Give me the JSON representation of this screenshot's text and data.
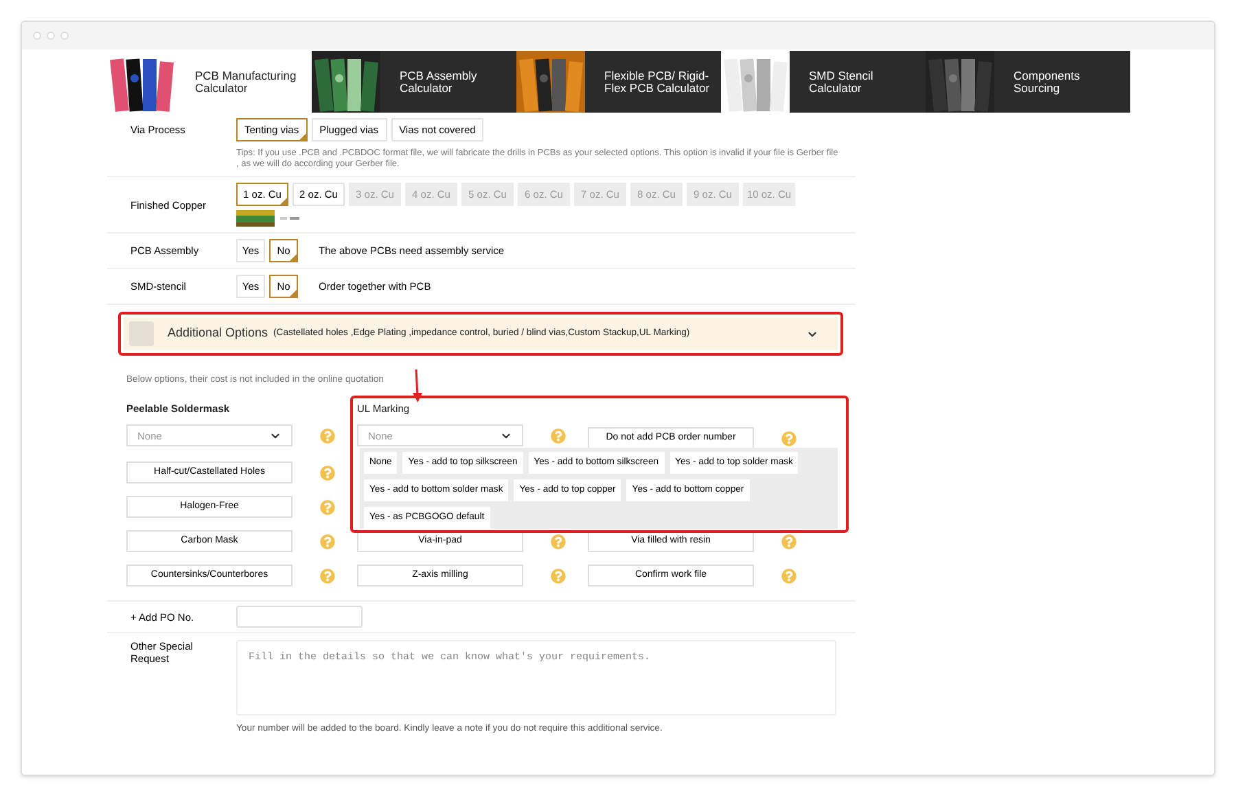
{
  "tabs": [
    {
      "label": "PCB Manufacturing Calculator",
      "selected": true
    },
    {
      "label": "PCB Assembly Calculator",
      "selected": false
    },
    {
      "label": "Flexible PCB/ Rigid-Flex PCB Calculator",
      "selected": false
    },
    {
      "label": "SMD Stencil Calculator",
      "selected": false
    },
    {
      "label": "Components Sourcing",
      "selected": false
    }
  ],
  "via_process": {
    "label": "Via Process",
    "options": [
      {
        "label": "Tenting vias",
        "selected": true,
        "disabled": false
      },
      {
        "label": "Plugged vias",
        "selected": false,
        "disabled": false
      },
      {
        "label": "Vias not covered",
        "selected": false,
        "disabled": false
      }
    ],
    "tip": "Tips: If you use .PCB and .PCBDOC format file, we will fabricate the drills in PCBs as your selected options. This option is invalid if your file is Gerber file , as we will do according your Gerber file."
  },
  "finished_copper": {
    "label": "Finished Copper",
    "options": [
      {
        "label": "1 oz. Cu",
        "selected": true,
        "disabled": false
      },
      {
        "label": "2 oz. Cu",
        "selected": false,
        "disabled": false
      },
      {
        "label": "3 oz. Cu",
        "selected": false,
        "disabled": true
      },
      {
        "label": "4 oz. Cu",
        "selected": false,
        "disabled": true
      },
      {
        "label": "5 oz. Cu",
        "selected": false,
        "disabled": true
      },
      {
        "label": "6 oz. Cu",
        "selected": false,
        "disabled": true
      },
      {
        "label": "7 oz. Cu",
        "selected": false,
        "disabled": true
      },
      {
        "label": "8 oz. Cu",
        "selected": false,
        "disabled": true
      },
      {
        "label": "9 oz. Cu",
        "selected": false,
        "disabled": true
      },
      {
        "label": "10 oz. Cu",
        "selected": false,
        "disabled": true
      }
    ]
  },
  "pcb_assembly": {
    "label": "PCB Assembly",
    "options": [
      {
        "label": "Yes",
        "selected": false,
        "disabled": false
      },
      {
        "label": "No",
        "selected": true,
        "disabled": false
      }
    ],
    "note": "The above PCBs need assembly service"
  },
  "smd_stencil": {
    "label": "SMD-stencil",
    "options": [
      {
        "label": "Yes",
        "selected": false,
        "disabled": false
      },
      {
        "label": "No",
        "selected": true,
        "disabled": false
      }
    ],
    "note": "Order together with PCB"
  },
  "additional_options": {
    "title": "Additional Options",
    "details": "(Castellated holes ,Edge Plating ,impedance control, buried / blind vias,Custom Stackup,UL Marking)"
  },
  "options_note": "Below options, their cost is not included in the online quotation",
  "peelable_soldermask": {
    "label": "Peelable Soldermask",
    "value": "None"
  },
  "ul_marking": {
    "label": "UL Marking",
    "value": "None",
    "menu": [
      "None",
      "Yes - add to top silkscreen",
      "Yes - add to bottom silkscreen",
      "Yes - add to top solder mask",
      "Yes - add to bottom solder mask",
      "Yes - add to top copper",
      "Yes - add to bottom copper",
      "Yes - as PCBGOGO default"
    ]
  },
  "order_number": "Do not add PCB order number",
  "option_rows": [
    [
      "Half-cut/Castellated Holes"
    ],
    [
      "Halogen-Free"
    ],
    [
      "Carbon Mask",
      "Via-in-pad",
      "Via filled with resin"
    ],
    [
      "Countersinks/Counterbores",
      "Z-axis milling",
      "Confirm work file"
    ]
  ],
  "po": {
    "label": "+ Add PO No."
  },
  "special_request": {
    "label": "Other Special Request",
    "placeholder": "Fill in the details so that we can know what's your requirements.",
    "note": "Your number will be added to the board. Kindly leave a note if you do not require this additional service."
  }
}
